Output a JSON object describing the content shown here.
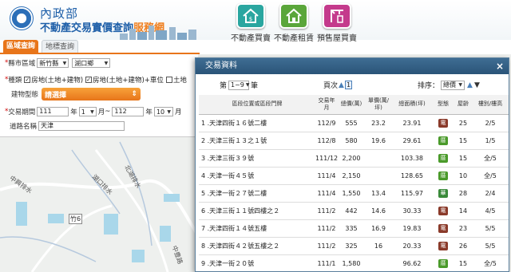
{
  "header": {
    "ministry": "內政部",
    "site_title_main": "不動產交易實價查詢",
    "site_title_highlight": "服務網",
    "nav": [
      {
        "label": "不動產買賣",
        "icon": "house-sale-icon",
        "color": "#2aa6a0"
      },
      {
        "label": "不動產租賃",
        "icon": "house-rent-icon",
        "color": "#5aa63a"
      },
      {
        "label": "預售屋買賣",
        "icon": "presale-crane-icon",
        "color": "#c43a8c"
      }
    ]
  },
  "tabs": {
    "active": "區域查詢",
    "inactive": "地標查詢"
  },
  "query": {
    "area_label": "縣市區域",
    "county": "新竹縣",
    "district": "湖口鄉",
    "type_label": "種類",
    "types": [
      {
        "label": "房地(土地+建物)",
        "checked": true
      },
      {
        "label": "房地(土地+建物)+車位",
        "checked": true
      },
      {
        "label": "土地",
        "checked": false
      }
    ],
    "building_label": "建物型態",
    "building_value": "請選擇",
    "period_label": "交易期間",
    "year_from": "111",
    "month_from": "1",
    "year_to": "112",
    "month_to": "10",
    "unit_year": "年",
    "unit_month": "月",
    "tilde": "~",
    "road_label": "道路名稱",
    "road_value": "天津"
  },
  "map_labels": [
    "北湖排水",
    "中興排水",
    "北湖排水",
    "湖口排水",
    "竹6",
    "中豊路"
  ],
  "modal": {
    "title": "交易資料",
    "close": "×",
    "page_prefix": "第",
    "page_value": "1~9",
    "page_suffix": "筆",
    "pager_label": "頁次",
    "pager_value": "1",
    "sort_label": "排序：",
    "sort_value": "總價"
  },
  "table": {
    "headers": [
      "區段位置或區段門牌",
      "交易年月",
      "總價(萬)",
      "單價(萬/坪)",
      "總面積(坪)",
      "型態",
      "屋齡",
      "樓別/樓高"
    ],
    "rows": [
      {
        "addr": "1 .天津四街１６號二樓",
        "ym": "112/9",
        "total": "555",
        "unit": "23.2",
        "area": "23.91",
        "type": "電",
        "type_color": "#8a3a2a",
        "age": "25",
        "floor": "2/5"
      },
      {
        "addr": "2 .天津三街１３之１號",
        "ym": "112/8",
        "total": "580",
        "unit": "19.6",
        "area": "29.61",
        "type": "厝",
        "type_color": "#4a9a2a",
        "age": "15",
        "floor": "1/5"
      },
      {
        "addr": "3 .天津三街３９號",
        "ym": "111/12",
        "total": "2,200",
        "unit": "",
        "area": "103.38",
        "type": "厝",
        "type_color": "#4a9a2a",
        "age": "15",
        "floor": "全/5"
      },
      {
        "addr": "4 .天津一街４５號",
        "ym": "111/4",
        "total": "2,150",
        "unit": "",
        "area": "128.65",
        "type": "厝",
        "type_color": "#4a9a2a",
        "age": "10",
        "floor": "全/5"
      },
      {
        "addr": "5 .天津一街２７號二樓",
        "ym": "111/4",
        "total": "1,550",
        "unit": "13.4",
        "area": "115.97",
        "type": "華",
        "type_color": "#3a8a3a",
        "age": "28",
        "floor": "2/4"
      },
      {
        "addr": "6 .天津三街１１號四樓之２",
        "ym": "111/2",
        "total": "442",
        "unit": "14.6",
        "area": "30.33",
        "type": "電",
        "type_color": "#8a3a2a",
        "age": "14",
        "floor": "4/5"
      },
      {
        "addr": "7 .天津四街１４號五樓",
        "ym": "111/2",
        "total": "335",
        "unit": "16.9",
        "area": "19.83",
        "type": "電",
        "type_color": "#8a3a2a",
        "age": "23",
        "floor": "5/5"
      },
      {
        "addr": "8 .天津四街４２號五樓之２",
        "ym": "111/2",
        "total": "325",
        "unit": "16",
        "area": "20.33",
        "type": "電",
        "type_color": "#8a3a2a",
        "age": "26",
        "floor": "5/5"
      },
      {
        "addr": "9 .天津一街２０號",
        "ym": "111/1",
        "total": "1,580",
        "unit": "",
        "area": "96.62",
        "type": "厝",
        "type_color": "#4a9a2a",
        "age": "15",
        "floor": "全/5"
      }
    ]
  }
}
